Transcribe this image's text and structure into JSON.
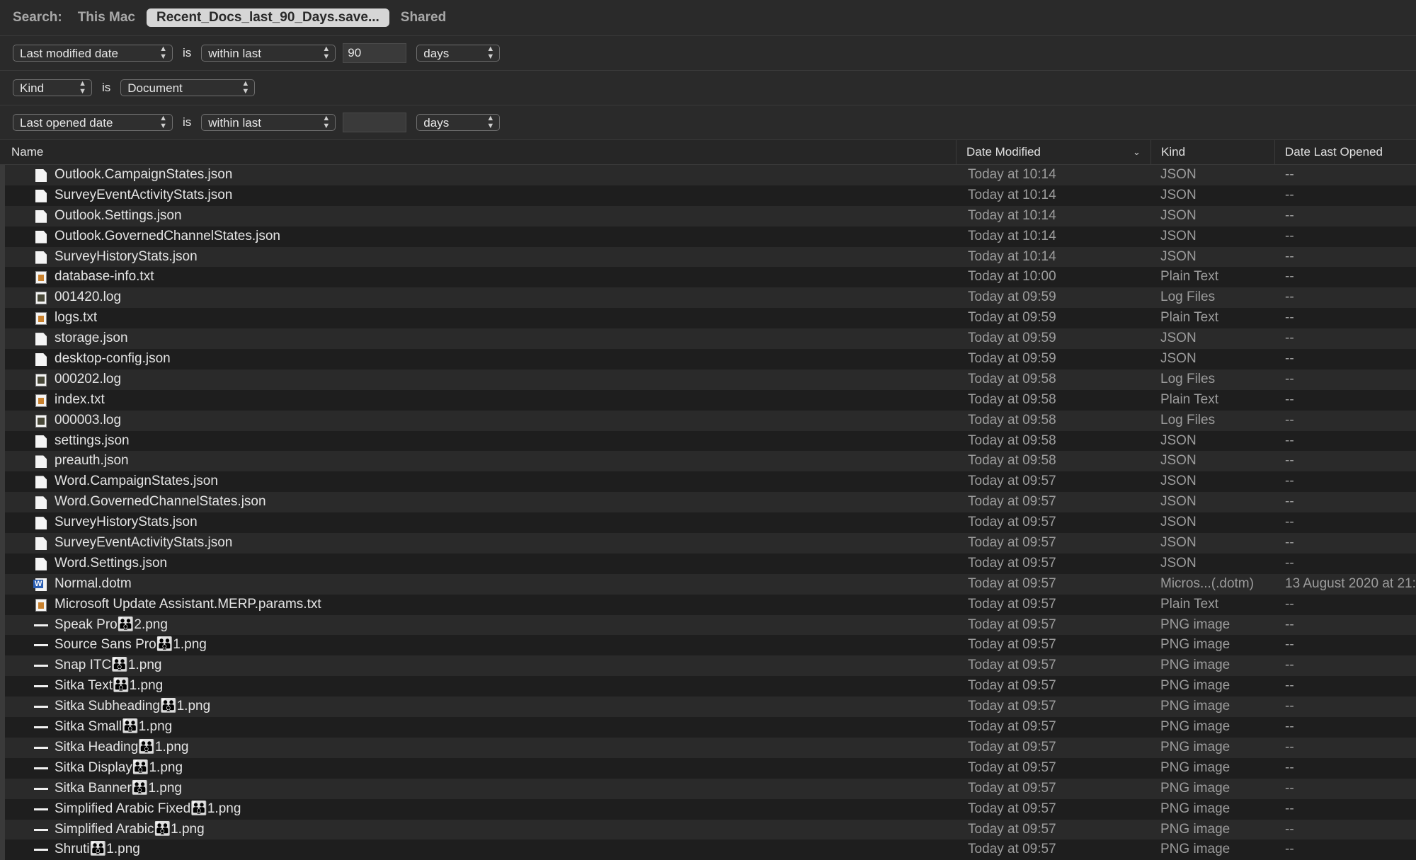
{
  "scope": {
    "label": "Search:",
    "items": [
      "This Mac",
      "Recent_Docs_last_90_Days.save...",
      "Shared"
    ]
  },
  "criteria": [
    {
      "attribute": "Last modified date",
      "operator": "is",
      "condition": "within last",
      "value": "90",
      "unit": "days"
    },
    {
      "attribute": "Kind",
      "operator": "is",
      "condition": "Document"
    },
    {
      "attribute": "Last opened date",
      "operator": "is",
      "condition": "within last",
      "value": "",
      "unit": "days"
    }
  ],
  "columns": {
    "name": "Name",
    "date_modified": "Date Modified",
    "kind": "Kind",
    "date_last_opened": "Date Last Opened"
  },
  "sort_icon": "chevron-down-icon",
  "files": [
    {
      "icon": "json",
      "name": "Outlook.CampaignStates.json",
      "modified": "Today at 10:14",
      "kind": "JSON",
      "opened": "--"
    },
    {
      "icon": "json",
      "name": "SurveyEventActivityStats.json",
      "modified": "Today at 10:14",
      "kind": "JSON",
      "opened": "--"
    },
    {
      "icon": "json",
      "name": "Outlook.Settings.json",
      "modified": "Today at 10:14",
      "kind": "JSON",
      "opened": "--"
    },
    {
      "icon": "json",
      "name": "Outlook.GovernedChannelStates.json",
      "modified": "Today at 10:14",
      "kind": "JSON",
      "opened": "--"
    },
    {
      "icon": "json",
      "name": "SurveyHistoryStats.json",
      "modified": "Today at 10:14",
      "kind": "JSON",
      "opened": "--"
    },
    {
      "icon": "text",
      "name": "database-info.txt",
      "modified": "Today at 10:00",
      "kind": "Plain Text",
      "opened": "--"
    },
    {
      "icon": "log",
      "name": "001420.log",
      "modified": "Today at 09:59",
      "kind": "Log Files",
      "opened": "--"
    },
    {
      "icon": "text",
      "name": "logs.txt",
      "modified": "Today at 09:59",
      "kind": "Plain Text",
      "opened": "--"
    },
    {
      "icon": "json",
      "name": "storage.json",
      "modified": "Today at 09:59",
      "kind": "JSON",
      "opened": "--"
    },
    {
      "icon": "json",
      "name": "desktop-config.json",
      "modified": "Today at 09:59",
      "kind": "JSON",
      "opened": "--"
    },
    {
      "icon": "log",
      "name": "000202.log",
      "modified": "Today at 09:58",
      "kind": "Log Files",
      "opened": "--"
    },
    {
      "icon": "text",
      "name": "index.txt",
      "modified": "Today at 09:58",
      "kind": "Plain Text",
      "opened": "--"
    },
    {
      "icon": "log",
      "name": "000003.log",
      "modified": "Today at 09:58",
      "kind": "Log Files",
      "opened": "--"
    },
    {
      "icon": "json",
      "name": "settings.json",
      "modified": "Today at 09:58",
      "kind": "JSON",
      "opened": "--"
    },
    {
      "icon": "json",
      "name": "preauth.json",
      "modified": "Today at 09:58",
      "kind": "JSON",
      "opened": "--"
    },
    {
      "icon": "json",
      "name": "Word.CampaignStates.json",
      "modified": "Today at 09:57",
      "kind": "JSON",
      "opened": "--"
    },
    {
      "icon": "json",
      "name": "Word.GovernedChannelStates.json",
      "modified": "Today at 09:57",
      "kind": "JSON",
      "opened": "--"
    },
    {
      "icon": "json",
      "name": "SurveyHistoryStats.json",
      "modified": "Today at 09:57",
      "kind": "JSON",
      "opened": "--"
    },
    {
      "icon": "json",
      "name": "SurveyEventActivityStats.json",
      "modified": "Today at 09:57",
      "kind": "JSON",
      "opened": "--"
    },
    {
      "icon": "json",
      "name": "Word.Settings.json",
      "modified": "Today at 09:57",
      "kind": "JSON",
      "opened": "--"
    },
    {
      "icon": "word",
      "name": "Normal.dotm",
      "modified": "Today at 09:57",
      "kind": "Micros...(.dotm)",
      "opened": "13 August 2020 at 21:"
    },
    {
      "icon": "text",
      "name": "Microsoft Update Assistant.MERP.params.txt",
      "modified": "Today at 09:57",
      "kind": "Plain Text",
      "opened": "--"
    },
    {
      "icon": "png",
      "name": "Speak Pro👪2.png",
      "modified": "Today at 09:57",
      "kind": "PNG image",
      "opened": "--"
    },
    {
      "icon": "png",
      "name": "Source Sans Pro👪1.png",
      "modified": "Today at 09:57",
      "kind": "PNG image",
      "opened": "--"
    },
    {
      "icon": "png",
      "name": "Snap ITC👪1.png",
      "modified": "Today at 09:57",
      "kind": "PNG image",
      "opened": "--"
    },
    {
      "icon": "png",
      "name": "Sitka Text👪1.png",
      "modified": "Today at 09:57",
      "kind": "PNG image",
      "opened": "--"
    },
    {
      "icon": "png",
      "name": "Sitka Subheading👪1.png",
      "modified": "Today at 09:57",
      "kind": "PNG image",
      "opened": "--"
    },
    {
      "icon": "png",
      "name": "Sitka Small👪1.png",
      "modified": "Today at 09:57",
      "kind": "PNG image",
      "opened": "--"
    },
    {
      "icon": "png",
      "name": "Sitka Heading👪1.png",
      "modified": "Today at 09:57",
      "kind": "PNG image",
      "opened": "--"
    },
    {
      "icon": "png",
      "name": "Sitka Display👪1.png",
      "modified": "Today at 09:57",
      "kind": "PNG image",
      "opened": "--"
    },
    {
      "icon": "png",
      "name": "Sitka Banner👪1.png",
      "modified": "Today at 09:57",
      "kind": "PNG image",
      "opened": "--"
    },
    {
      "icon": "png",
      "name": "Simplified Arabic Fixed👪1.png",
      "modified": "Today at 09:57",
      "kind": "PNG image",
      "opened": "--"
    },
    {
      "icon": "png",
      "name": "Simplified Arabic👪1.png",
      "modified": "Today at 09:57",
      "kind": "PNG image",
      "opened": "--"
    },
    {
      "icon": "png",
      "name": "Shruti👪1.png",
      "modified": "Today at 09:57",
      "kind": "PNG image",
      "opened": "--"
    }
  ]
}
